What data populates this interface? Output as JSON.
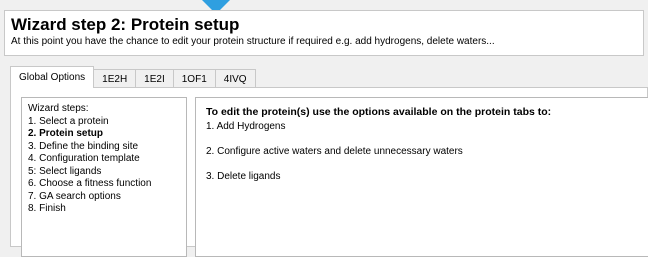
{
  "colors": {
    "accent": "#2f9fe0",
    "panel_bg": "#ffffff",
    "window_bg": "#f0f0f0",
    "border": "#c8c8c8"
  },
  "header": {
    "title": "Wizard step 2: Protein setup",
    "subtitle": "At this point you have the chance to edit your protein structure if required e.g. add hydrogens, delete waters..."
  },
  "tabs": [
    {
      "label": "Global Options",
      "active": true
    },
    {
      "label": "1E2H",
      "active": false
    },
    {
      "label": "1E2I",
      "active": false
    },
    {
      "label": "1OF1",
      "active": false
    },
    {
      "label": "4IVQ",
      "active": false
    }
  ],
  "steps_panel": {
    "heading": "Wizard steps:",
    "steps": [
      "1. Select a protein",
      "2. Protein setup",
      "3. Define the binding site",
      "4. Configuration template",
      "5: Select ligands",
      "6. Choose a fitness function",
      "7. GA search options",
      "8. Finish"
    ],
    "current_index": 1
  },
  "content": {
    "title": "To edit the protein(s) use the options available on the protein tabs to:",
    "items": [
      "1. Add Hydrogens",
      "2. Configure active waters and delete unnecessary waters",
      "3. Delete ligands"
    ]
  }
}
